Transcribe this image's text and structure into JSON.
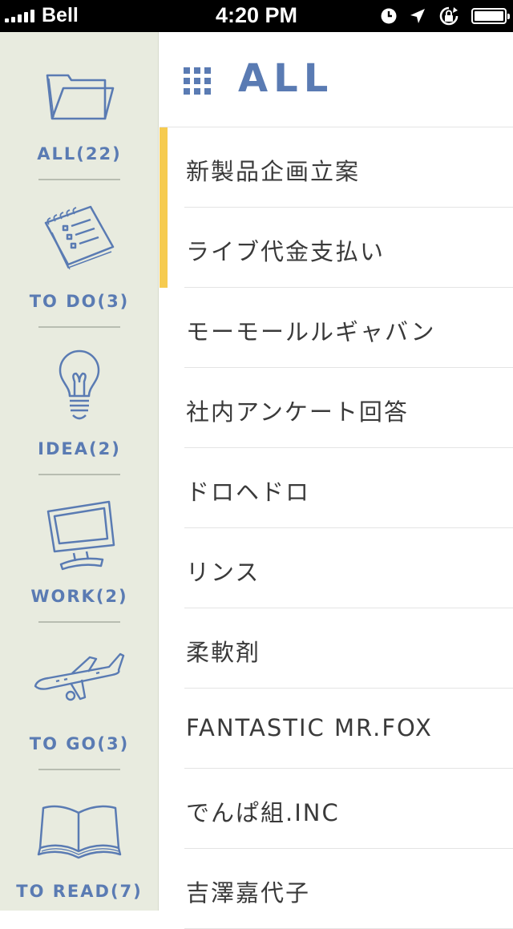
{
  "status_bar": {
    "carrier": "Bell",
    "time": "4:20 PM"
  },
  "header": {
    "title": "ALL"
  },
  "sidebar": {
    "categories": [
      {
        "label": "ALL(22)",
        "icon": "folder-icon"
      },
      {
        "label": "TO DO(3)",
        "icon": "notepad-icon"
      },
      {
        "label": "IDEA(2)",
        "icon": "lightbulb-icon"
      },
      {
        "label": "WORK(2)",
        "icon": "monitor-icon"
      },
      {
        "label": "TO GO(3)",
        "icon": "airplane-icon"
      },
      {
        "label": "TO READ(7)",
        "icon": "book-icon"
      }
    ]
  },
  "list": {
    "items": [
      "新製品企画立案",
      "ライブ代金支払い",
      "モーモールルギャバン",
      "社内アンケート回答",
      "ドロヘドロ",
      "リンス",
      "柔軟剤",
      "FANTASTIC MR.FOX",
      "でんぱ組.INC",
      "吉澤嘉代子"
    ],
    "highlighted_rows": [
      0,
      1
    ]
  },
  "colors": {
    "accent_blue": "#5a7bb3",
    "sidebar_bg": "#e8ebdf",
    "highlight_yellow": "#f6cb4f"
  }
}
